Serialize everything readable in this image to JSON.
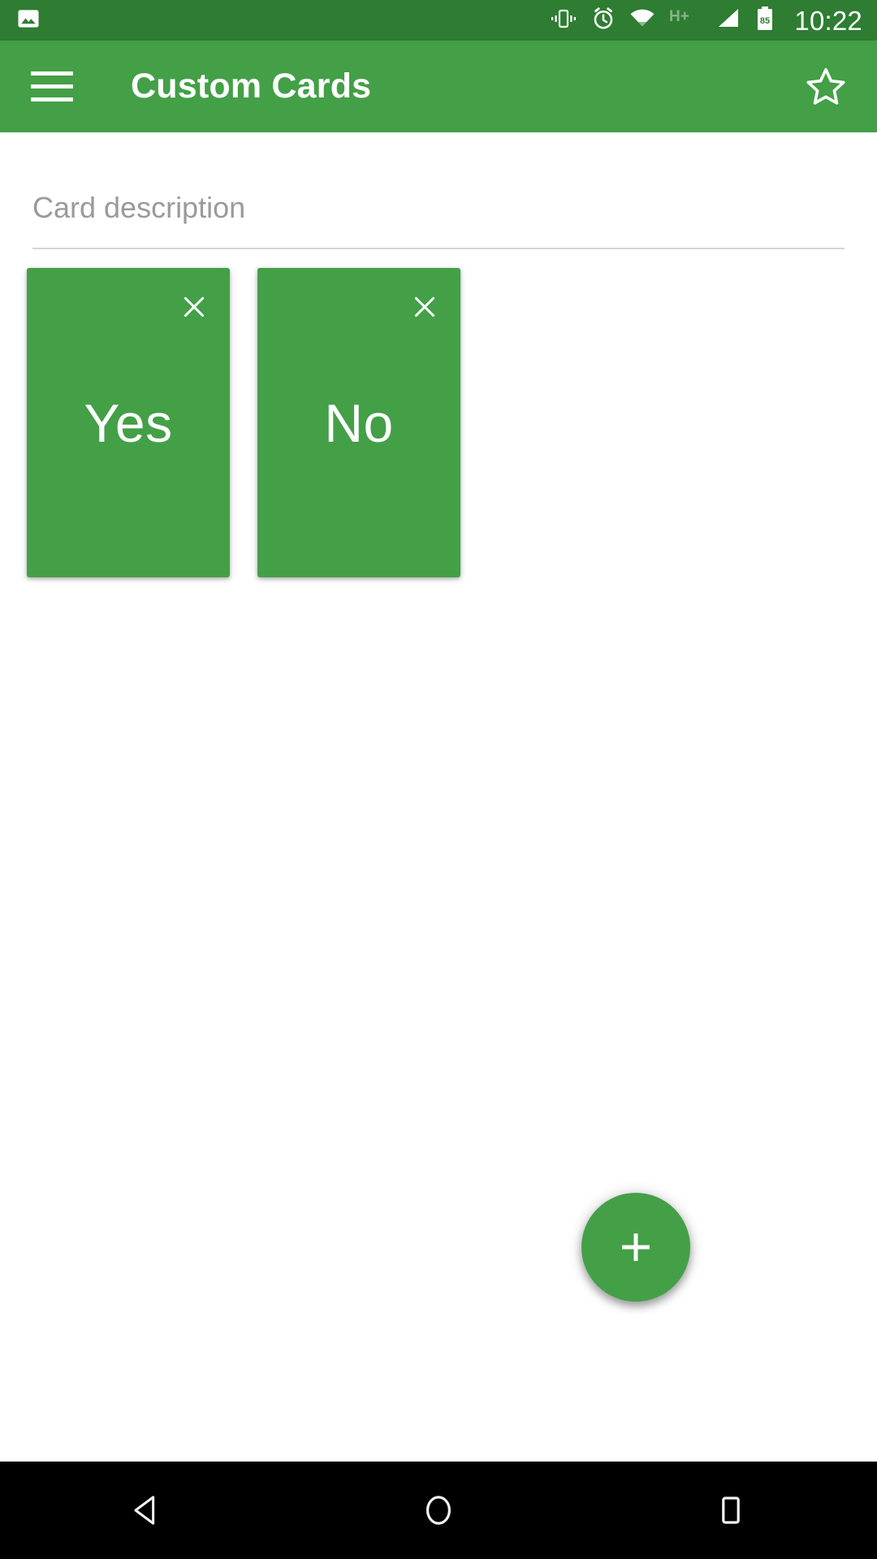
{
  "status_bar": {
    "background_color": "#2E7D32",
    "time": "10:22",
    "battery_level": "85",
    "network_type": "H+",
    "icons": [
      "photo-notification-icon",
      "vibrate-icon",
      "alarm-icon",
      "wifi-icon",
      "network-hplus-icon",
      "cellular-signal-icon",
      "battery-icon"
    ]
  },
  "toolbar": {
    "background_color": "#43A047",
    "title": "Custom Cards",
    "menu_icon": "hamburger-menu-icon",
    "action_icon": "star-outline-icon"
  },
  "content": {
    "description_field": {
      "value": "",
      "placeholder": "Card description"
    },
    "cards": [
      {
        "label": "Yes",
        "close_icon": "close-icon",
        "color": "#43A047"
      },
      {
        "label": "No",
        "close_icon": "close-icon",
        "color": "#43A047"
      }
    ]
  },
  "fab": {
    "icon": "plus-icon",
    "color": "#43A047"
  },
  "nav_bar": {
    "background_color": "#000000",
    "buttons": [
      {
        "name": "back",
        "icon": "back-triangle-icon"
      },
      {
        "name": "home",
        "icon": "home-circle-icon"
      },
      {
        "name": "recents",
        "icon": "recents-square-icon"
      }
    ]
  }
}
